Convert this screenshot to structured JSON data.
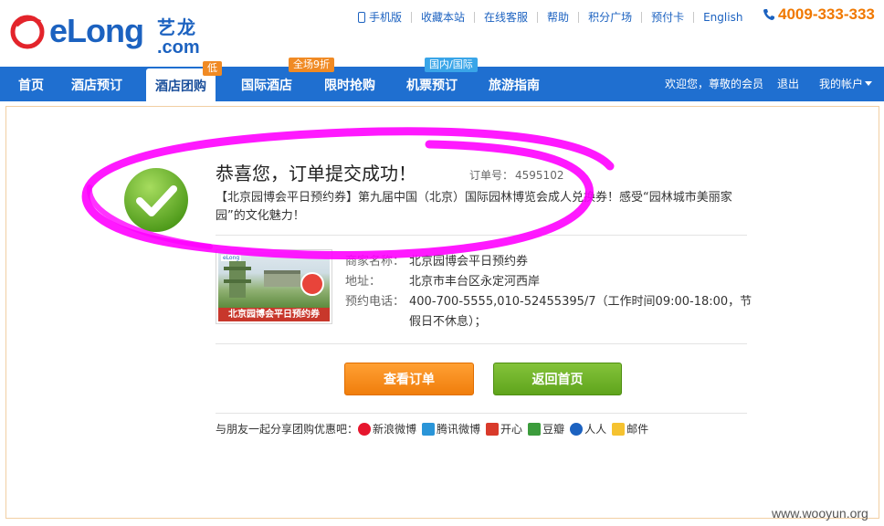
{
  "header": {
    "logo_text": "eLong",
    "logo_cn": "艺龙",
    "logo_com": ".com",
    "top_links": [
      "手机版",
      "收藏本站",
      "在线客服",
      "帮助",
      "积分广场",
      "预付卡",
      "English"
    ],
    "hotline": "4009-333-333"
  },
  "nav": {
    "items": [
      {
        "label": "首页"
      },
      {
        "label": "酒店预订"
      },
      {
        "label": "酒店团购",
        "badge": "低"
      },
      {
        "label": "国际酒店",
        "badge": "全场9折"
      },
      {
        "label": "限时抢购"
      },
      {
        "label": "机票预订",
        "badge": "国内/国际"
      },
      {
        "label": "旅游指南"
      }
    ],
    "welcome": "欢迎您，尊敬的会员",
    "logout": "退出",
    "account": "我的帐户"
  },
  "result": {
    "title": "恭喜您，订单提交成功！",
    "order_label": "订单号：",
    "order_number": "4595102",
    "description": "【北京园博会平日预约券】第九届中国（北京）国际园林博览会成人兑换券！感受“园林城市美丽家园”的文化魅力！"
  },
  "voucher": {
    "image_text": "北京园博会平日预约券",
    "brand": "eLong"
  },
  "merchant": {
    "name_label": "商家名称：",
    "name": "北京园博会平日预约券",
    "address_label": "地址：",
    "address": "北京市丰台区永定河西岸",
    "phone_label": "预约电话：",
    "phone_line1": "400-700-5555,010-52455395/7（工作时间09:00-18:00，节",
    "phone_line2": "假日不休息）；"
  },
  "buttons": {
    "view_order": "查看订单",
    "back_home": "返回首页"
  },
  "share": {
    "label": "与朋友一起分享团购优惠吧：",
    "items": [
      {
        "label": "新浪微博",
        "icon": "weibo-icon"
      },
      {
        "label": "腾讯微博",
        "icon": "tencent-weibo-icon"
      },
      {
        "label": "开心",
        "icon": "kaixin-icon"
      },
      {
        "label": "豆瓣",
        "icon": "douban-icon"
      },
      {
        "label": "人人",
        "icon": "renren-icon"
      },
      {
        "label": "邮件",
        "icon": "mail-icon"
      }
    ]
  },
  "watermark": "www.wooyun.org",
  "colors": {
    "brand_blue": "#1c62c0",
    "nav_blue": "#1f6fd0",
    "accent_orange": "#f07800",
    "success_green": "#6cb52b",
    "annotation_magenta": "#ff00ff"
  }
}
